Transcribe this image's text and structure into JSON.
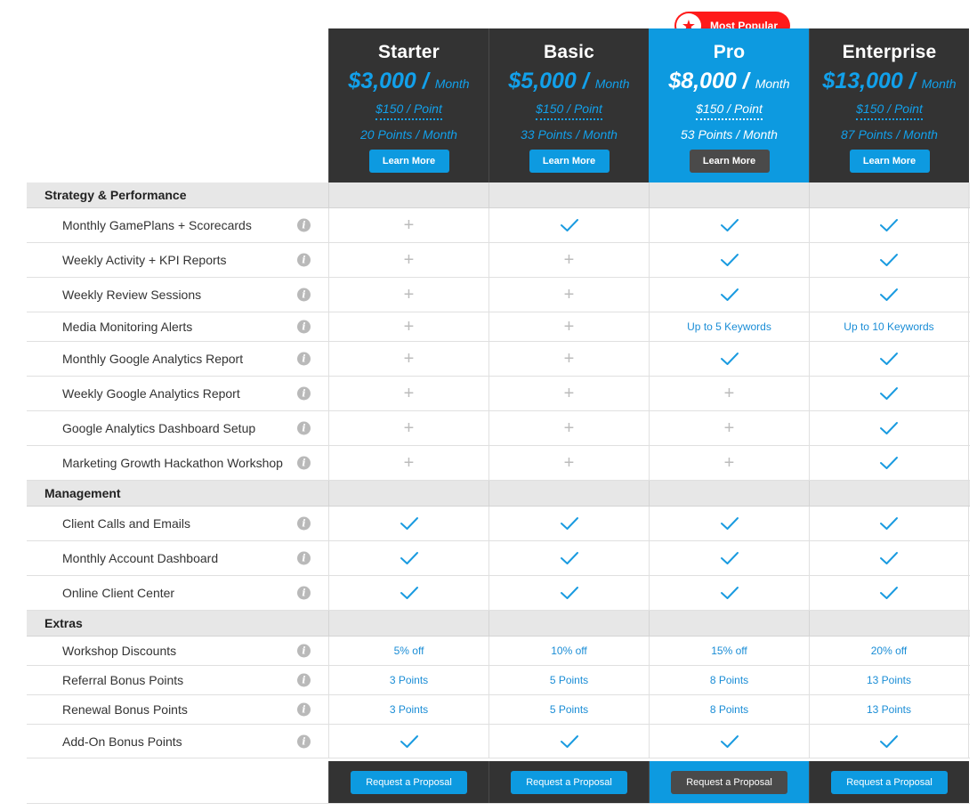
{
  "badge": {
    "label": "Most Popular"
  },
  "plans": [
    {
      "name": "Starter",
      "price": "$3,000 /",
      "per": "Month",
      "point_price": "$150 / Point",
      "points": "20 Points / Month",
      "learn": "Learn More"
    },
    {
      "name": "Basic",
      "price": "$5,000 /",
      "per": "Month",
      "point_price": "$150 / Point",
      "points": "33 Points / Month",
      "learn": "Learn More"
    },
    {
      "name": "Pro",
      "price": "$8,000 /",
      "per": "Month",
      "point_price": "$150 / Point",
      "points": "53 Points / Month",
      "learn": "Learn More"
    },
    {
      "name": "Enterprise",
      "price": "$13,000 /",
      "per": "Month",
      "point_price": "$150 / Point",
      "points": "87 Points / Month",
      "learn": "Learn More"
    }
  ],
  "sections": [
    {
      "title": "Strategy & Performance",
      "rows": [
        {
          "label": "Monthly GamePlans + Scorecards",
          "cells": [
            "plus",
            "check",
            "check",
            "check"
          ]
        },
        {
          "label": "Weekly Activity + KPI Reports",
          "cells": [
            "plus",
            "plus",
            "check",
            "check"
          ]
        },
        {
          "label": "Weekly Review Sessions",
          "cells": [
            "plus",
            "plus",
            "check",
            "check"
          ]
        },
        {
          "label": "Media Monitoring Alerts",
          "cells": [
            "plus",
            "plus",
            "Up to 5 Keywords",
            "Up to 10 Keywords"
          ]
        },
        {
          "label": "Monthly Google Analytics Report",
          "cells": [
            "plus",
            "plus",
            "check",
            "check"
          ]
        },
        {
          "label": "Weekly Google Analytics Report",
          "cells": [
            "plus",
            "plus",
            "plus",
            "check"
          ]
        },
        {
          "label": "Google Analytics Dashboard Setup",
          "cells": [
            "plus",
            "plus",
            "plus",
            "check"
          ]
        },
        {
          "label": "Marketing Growth Hackathon Workshop",
          "cells": [
            "plus",
            "plus",
            "plus",
            "check"
          ]
        }
      ]
    },
    {
      "title": "Management",
      "rows": [
        {
          "label": "Client Calls and Emails",
          "cells": [
            "check",
            "check",
            "check",
            "check"
          ]
        },
        {
          "label": "Monthly Account Dashboard",
          "cells": [
            "check",
            "check",
            "check",
            "check"
          ]
        },
        {
          "label": "Online Client Center",
          "cells": [
            "check",
            "check",
            "check",
            "check"
          ]
        }
      ]
    },
    {
      "title": "Extras",
      "rows": [
        {
          "label": "Workshop Discounts",
          "cells": [
            "5% off",
            "10% off",
            "15% off",
            "20% off"
          ]
        },
        {
          "label": "Referral Bonus Points",
          "cells": [
            "3 Points",
            "5 Points",
            "8 Points",
            "13 Points"
          ]
        },
        {
          "label": "Renewal Bonus Points",
          "cells": [
            "3 Points",
            "5 Points",
            "8 Points",
            "13 Points"
          ]
        },
        {
          "label": "Add-On Bonus Points",
          "cells": [
            "check",
            "check",
            "check",
            "check"
          ]
        }
      ]
    }
  ],
  "footer": {
    "button_label": "Request a Proposal"
  },
  "icons": {
    "check": "checkmark-icon",
    "plus": "plus-icon",
    "info": "info-icon",
    "star": "star-icon"
  },
  "colors": {
    "accent": "#0d9ae0",
    "dark": "#333333",
    "badge": "#ff1a1a",
    "section_bg": "#e7e7e7"
  }
}
